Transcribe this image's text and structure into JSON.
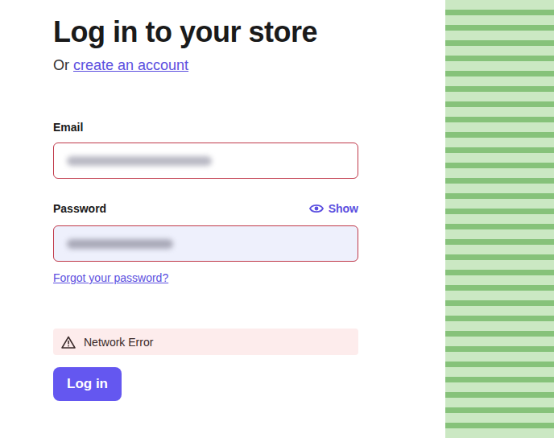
{
  "heading": "Log in to your store",
  "subheading": {
    "prefix": "Or",
    "link": "create an account"
  },
  "email": {
    "label": "Email",
    "blurred": true,
    "invalid": true
  },
  "password": {
    "label": "Password",
    "toggle": "Show",
    "blurred": true,
    "invalid": true,
    "autofilled": true
  },
  "forgot_link": "Forgot your password?",
  "error": {
    "message": "Network Error"
  },
  "button": "Log in"
}
